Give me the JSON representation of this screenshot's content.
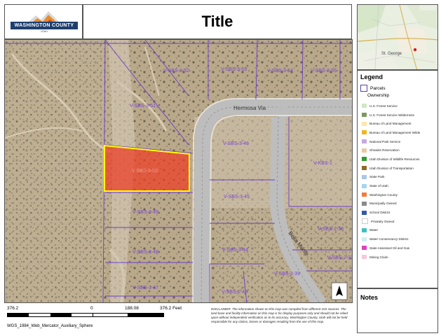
{
  "header": {
    "title": "Title",
    "logo_text": "WASHINGTON COUNTY",
    "logo_sub": "UTAH"
  },
  "inset_map": {
    "place_label": "St. George"
  },
  "map": {
    "roads": [
      "Hermosa Via",
      "Bella Monte"
    ],
    "parcels": [
      {
        "id": "V-SBS-3-52"
      },
      {
        "id": "V-SBS-3-53"
      },
      {
        "id": "V-SBS-3-54"
      },
      {
        "id": "V-SBS-3-55"
      },
      {
        "id": "V-SBS-3-51"
      },
      {
        "id": "V-SBS-3-46"
      },
      {
        "id": "V-SBS-3-50",
        "selected": true
      },
      {
        "id": "V-KBS-1"
      },
      {
        "id": "V-SBS-3-45"
      },
      {
        "id": "V-SBS-3-49"
      },
      {
        "id": "V-SBS-2-38"
      },
      {
        "id": "V-SBS-3-48"
      },
      {
        "id": "V-SBS-3-44"
      },
      {
        "id": "V-SBS-2-37"
      },
      {
        "id": "V-SBS-2-39"
      },
      {
        "id": "V-SBS-3-47"
      },
      {
        "id": "V-SBS-2-43"
      }
    ],
    "selected_parcel_color": "#ef3b24",
    "selected_outline_color": "#ffff00",
    "parcel_line_color": "#6a3fc8",
    "north_arrow": "north-arrow-icon"
  },
  "legend": {
    "title": "Legend",
    "parcels_label": "Parcels",
    "ownership_label": "Ownership",
    "items": [
      {
        "label": "U.S. Forest Service",
        "color": "#cfe8c4"
      },
      {
        "label": "U.S. Forest Service Wilderness",
        "color": "#7d9a5e"
      },
      {
        "label": "Bureau of Land Management",
        "color": "#fde6a8"
      },
      {
        "label": "Bureau of Land Management Wilde",
        "color": "#f2b61c"
      },
      {
        "label": "National Park Service",
        "color": "#c9a8e0"
      },
      {
        "label": "Shivwits Reservation",
        "color": "#e8c9a5"
      },
      {
        "label": "Utah Division of Wildlife Resources",
        "color": "#2e9e2e"
      },
      {
        "label": "Utah Division of Transportation",
        "color": "#8c6a2a"
      },
      {
        "label": "State Park",
        "color": "#a9c6e6"
      },
      {
        "label": "State of Utah",
        "color": "#a8d4f0"
      },
      {
        "label": "Washington County",
        "color": "#f07d3c"
      },
      {
        "label": "Municipally Owned",
        "color": "#8a8a8a"
      },
      {
        "label": "School District",
        "color": "#2f5aa8"
      },
      {
        "label": "Privately Owned",
        "color": "#ffffff"
      },
      {
        "label": "Water",
        "color": "#40c0c0"
      },
      {
        "label": "Water Conservancy District",
        "color": "#d0f0f0"
      },
      {
        "label": "State Assessed Oil and Gas",
        "color": "#e040c0"
      },
      {
        "label": "Mining Claim",
        "color": "#f8c8d8"
      }
    ]
  },
  "notes": {
    "title": "Notes"
  },
  "scale": {
    "left": "376.2",
    "zero": "0",
    "mid": "188.08",
    "right": "376.2 Feet",
    "projection": "WGS_1984_Web_Mercator_Auxiliary_Sphere"
  },
  "disclaimer": "DISCLAIMER: The information shown on this map was compiled from different GIS sources. The land base and facility information on this map is for display purposes only and should not be relied upon without independent verification as to its accuracy. Washington County, Utah will not be held responsible for any claims, losses or damages resulting from the use of this map."
}
